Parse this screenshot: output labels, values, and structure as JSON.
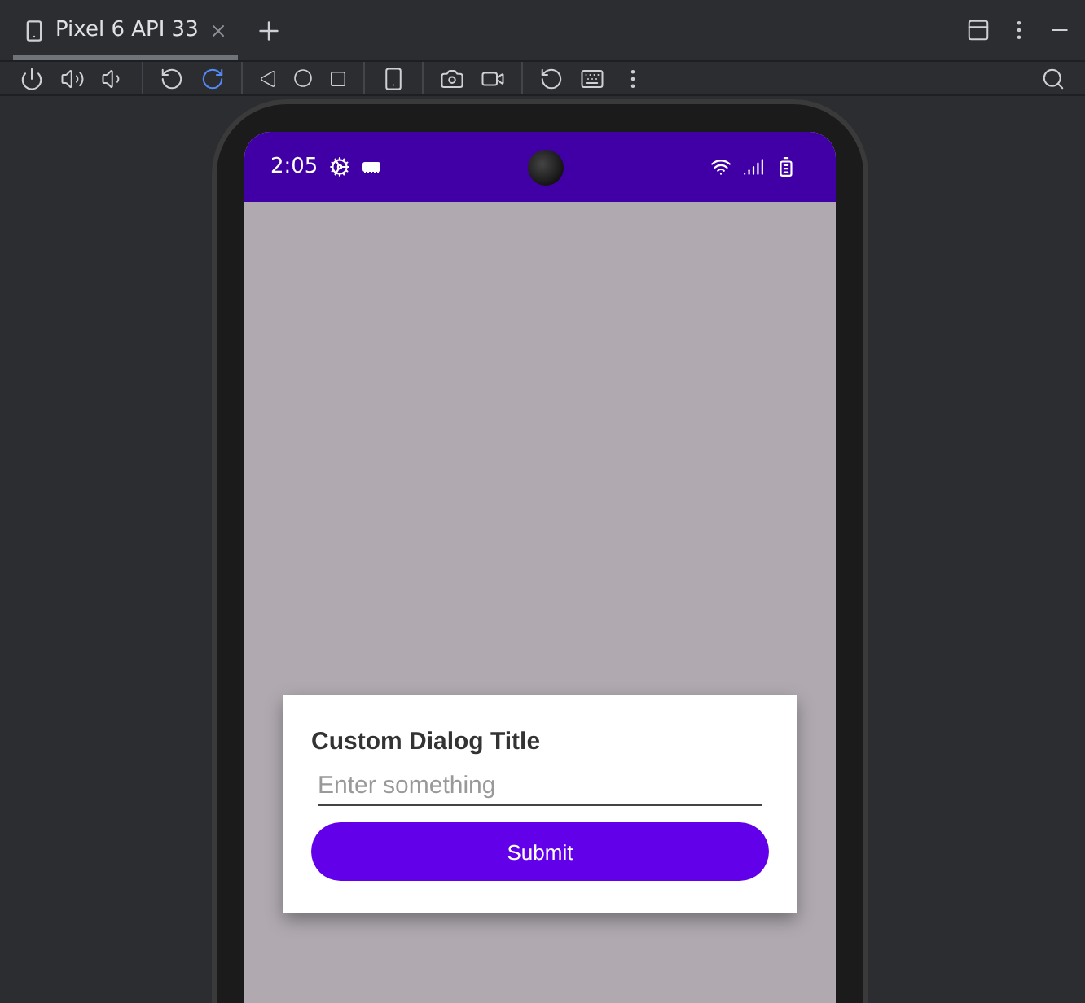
{
  "tabs": [
    {
      "label": "Pixel 6 API 33",
      "selected": true
    }
  ],
  "status_bar": {
    "time": "2:05"
  },
  "dialog": {
    "title": "Custom Dialog Title",
    "input": {
      "placeholder": "Enter something"
    },
    "button": "Submit"
  }
}
